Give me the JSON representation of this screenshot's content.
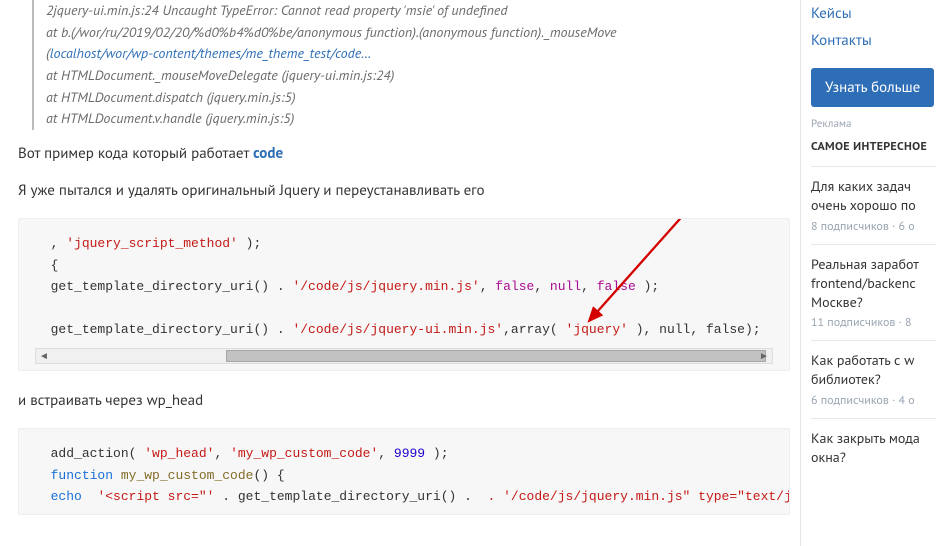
{
  "stacktrace": {
    "line1": "2jquery-ui.min.js:24 Uncaught TypeError: Cannot read property 'msie' of undefined",
    "line2": "at b.(/wor/ru/2019/02/20/%d0%b4%d0%be/anonymous function).(anonymous function)._mouseMove",
    "line3_prefix": "(",
    "line3_link": "localhost/wor/wp-content/themes/me_theme_test/code…",
    "line4": "at HTMLDocument._mouseMoveDelegate (jquery-ui.min.js:24)",
    "line5": "at HTMLDocument.dispatch (jquery.min.js:5)",
    "line6": "at HTMLDocument.v.handle (jquery.min.js:5)"
  },
  "para1": {
    "text": "Вот пример кода который работает ",
    "link": "code"
  },
  "para2": "Я уже пытался и удалять оригинальный Jquery и переустанавливать его",
  "code1": {
    "s_jqsm": "'jquery_script_method'",
    "tail1": " );",
    "brace_open": "{",
    "getdir": "get_template_directory_uri()",
    "dot_sp": " . ",
    "s_jqmin": "'/code/js/jquery.min.js'",
    "false": "false",
    "null": "null",
    "tail_fnf": ", false, null, false );",
    "s_jquimin": "'/code/js/jquery-ui.min.js'",
    "arr_open": ",array( ",
    "s_jquery": "'jquery'",
    "arr_close": " ), null, false);"
  },
  "para3": "и встраивать через wp_head",
  "code2": {
    "add_action_open": "add_action( ",
    "s_wphead": "'wp_head'",
    "s_mywp": "'my_wp_custom_code'",
    "num": "9999",
    "close": " );",
    "func_kw": "function",
    "funcname": "my_wp_custom_code",
    "parens": "() {",
    "echo_kw": "echo",
    "echo_open": " '<script src=\"'",
    "dot": " . ",
    "getdir": "get_template_directory_uri()",
    "echo_tail": " . '/code/js/jquery.min.js\" type=\"text/javasc"
  },
  "sidebar": {
    "links": [
      "Кейсы",
      "Контакты"
    ],
    "cta": "Узнать больше",
    "adlabel": "Реклама",
    "sect_title": "САМОЕ ИНТЕРЕСНОЕ",
    "items": [
      {
        "title": "Для каких задач очень хорошо по",
        "meta": "8 подписчиков · 6 о"
      },
      {
        "title": "Реальная заработ frontend/backenc Москве?",
        "meta": "11 подписчиков · 8"
      },
      {
        "title": "Как работать с w библиотек?",
        "meta": "6 подписчиков · 4 о"
      },
      {
        "title": "Как закрыть мода окна?",
        "meta": ""
      }
    ]
  }
}
